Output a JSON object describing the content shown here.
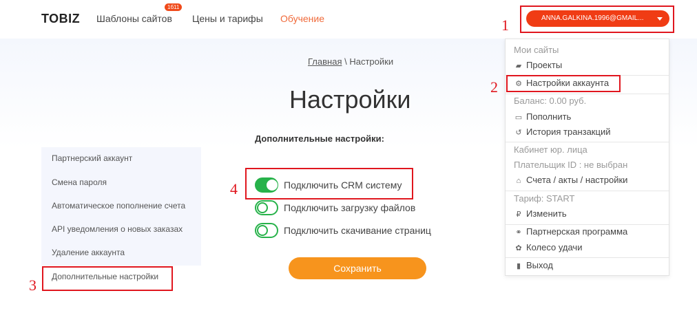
{
  "header": {
    "logo": "TOBIZ",
    "nav": {
      "templates": "Шаблоны сайтов",
      "templates_badge": "1б11",
      "prices": "Цены и тарифы",
      "learn": "Обучение"
    },
    "account_email": "ANNA.GALKINA.1996@GMAIL..."
  },
  "breadcrumb": {
    "home": "Главная",
    "separator": "\\",
    "current": "Настройки"
  },
  "page_title": "Настройки",
  "sidebar": {
    "items": [
      {
        "label": "Партнерский аккаунт"
      },
      {
        "label": "Смена пароля"
      },
      {
        "label": "Автоматическое пополнение счета"
      },
      {
        "label": "API уведомления о новых заказах"
      },
      {
        "label": "Удаление аккаунта"
      },
      {
        "label": "Дополнительные настройки"
      }
    ]
  },
  "section": {
    "title": "Дополнительные настройки:",
    "toggles": [
      {
        "label": "Подключить CRM систему",
        "on": true
      },
      {
        "label": "Подключить загрузку файлов",
        "on": false
      },
      {
        "label": "Подключить скачивание страниц",
        "on": false
      }
    ],
    "save_label": "Сохранить"
  },
  "dropdown": {
    "my_sites": "Мои сайты",
    "projects": "Проекты",
    "account_settings": "Настройки аккаунта",
    "balance": "Баланс: 0.00 руб.",
    "topup": "Пополнить",
    "transactions": "История транзакций",
    "legal_cabinet": "Кабинет юр. лица",
    "payer": "Плательщик ID : не выбран",
    "invoices": "Счета / акты / настройки",
    "tariff": "Тариф: START",
    "change": "Изменить",
    "partner_program": "Партнерская программа",
    "wheel": "Колесо удачи",
    "logout": "Выход"
  },
  "annotations": {
    "n1": "1",
    "n2": "2",
    "n3": "3",
    "n4": "4"
  },
  "colors": {
    "accent_red": "#f03c14",
    "save_orange": "#f7941d",
    "toggle_green": "#27b24a",
    "annotation_red": "#e0161e"
  }
}
